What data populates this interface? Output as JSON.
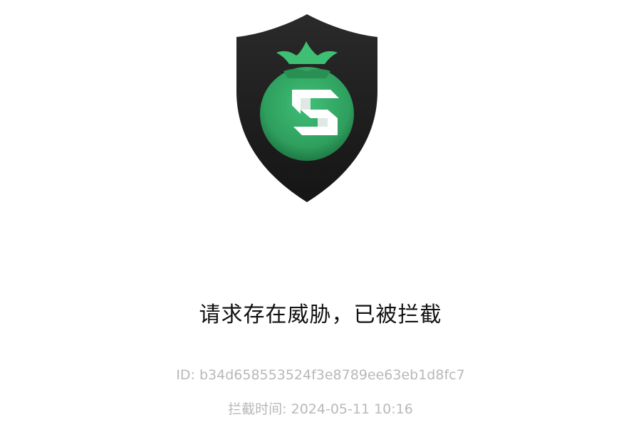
{
  "block_page": {
    "logo_icon": "shield-s-logo-icon",
    "title": "请求存在威胁，已被拦截",
    "id_line": "ID: b34d658553524f3e8789ee63eb1d8fc7",
    "time_line": "拦截时间: 2024-05-11 10:16"
  },
  "colors": {
    "shield": "#1c1c1c",
    "circle": "#34a965",
    "circle_dark": "#1f7a45",
    "crown": "#3fbf73",
    "letter": "#ffffff",
    "title_text": "#111111",
    "meta_text": "#b8b8b8"
  }
}
